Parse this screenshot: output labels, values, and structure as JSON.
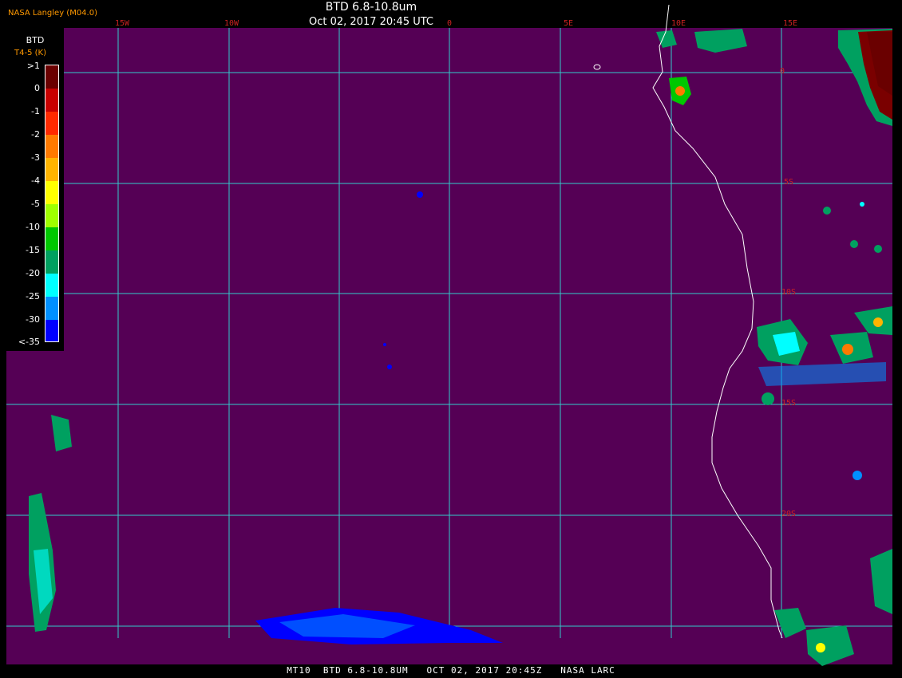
{
  "header": {
    "title": "BTD 6.8-10.8um",
    "subtitle": "Oct 02, 2017 20:45 UTC",
    "credit": "NASA Langley (M04.0)"
  },
  "map": {
    "background_color": "#550055",
    "grid_color": "#33cccc",
    "coastline_color": "#ffffff",
    "label_color": "#cc2222",
    "lon_labels": [
      "15W",
      "10W",
      "0",
      "5E",
      "10E",
      "15E"
    ],
    "lat_labels": [
      "0",
      "5S",
      "10S",
      "15S",
      "20S"
    ]
  },
  "legend": {
    "title": "BTD",
    "units": "T4-5 (K)",
    "labels": [
      ">1",
      "0",
      "-1",
      "-2",
      "-3",
      "-4",
      "-5",
      "-10",
      "-15",
      "-20",
      "-25",
      "-30",
      "<-35"
    ],
    "colors": [
      "#6a0000",
      "#c80000",
      "#ff2a00",
      "#ff7a00",
      "#ffb400",
      "#ffff00",
      "#a0ff00",
      "#00c800",
      "#00a060",
      "#00ffff",
      "#0090ff",
      "#0000ff",
      "#550055"
    ]
  },
  "footer": {
    "text": "MT10  BTD 6.8-10.8UM   OCT 02, 2017 20:45Z   NASA LARC"
  }
}
